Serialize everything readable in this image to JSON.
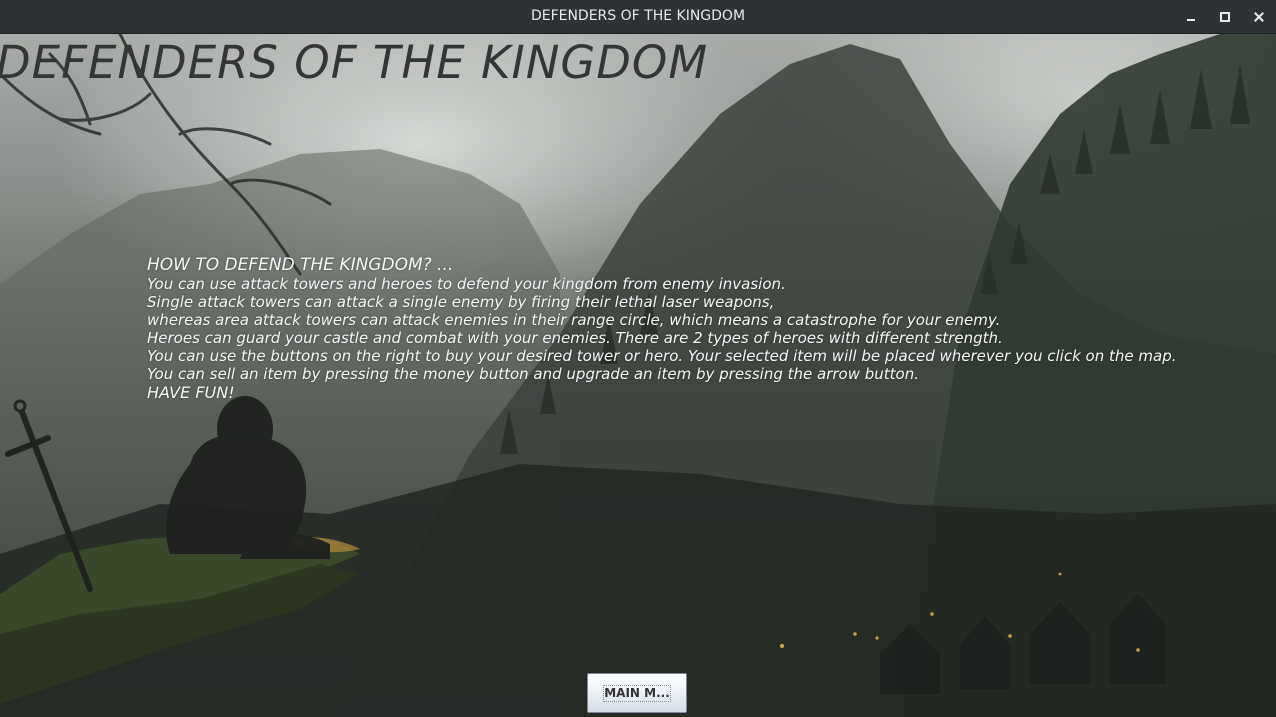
{
  "window": {
    "title": "DEFENDERS OF THE KINGDOM",
    "controls": {
      "minimize": "minimize-icon",
      "maximize": "maximize-icon",
      "close": "close-icon"
    }
  },
  "screen": {
    "game_title": "DEFENDERS OF THE KINGDOM",
    "instructions": {
      "heading": "HOW TO DEFEND THE KINGDOM? ...",
      "lines": [
        "You can use attack towers and heroes to defend your kingdom from enemy invasion.",
        "Single attack towers can attack a single enemy by firing their lethal laser weapons,",
        "whereas area attack towers can attack enemies in their range circle, which means a catastrophe for your enemy.",
        "Heroes can guard your castle and combat with your enemies. There are 2 types of heroes with different strength.",
        "You can use the buttons on the right to buy your desired tower or hero. Your selected item will be placed wherever you click on the map.",
        "You can sell an item by pressing the money button and upgrade an item by pressing the arrow button."
      ],
      "closing": "HAVE FUN!"
    },
    "main_menu_button": "MAIN M..."
  },
  "colors": {
    "title_bar": "#2e3235",
    "title_text": "#333634",
    "instruction_text": "#f6f6f6",
    "button_bg": "#eef2f7"
  }
}
